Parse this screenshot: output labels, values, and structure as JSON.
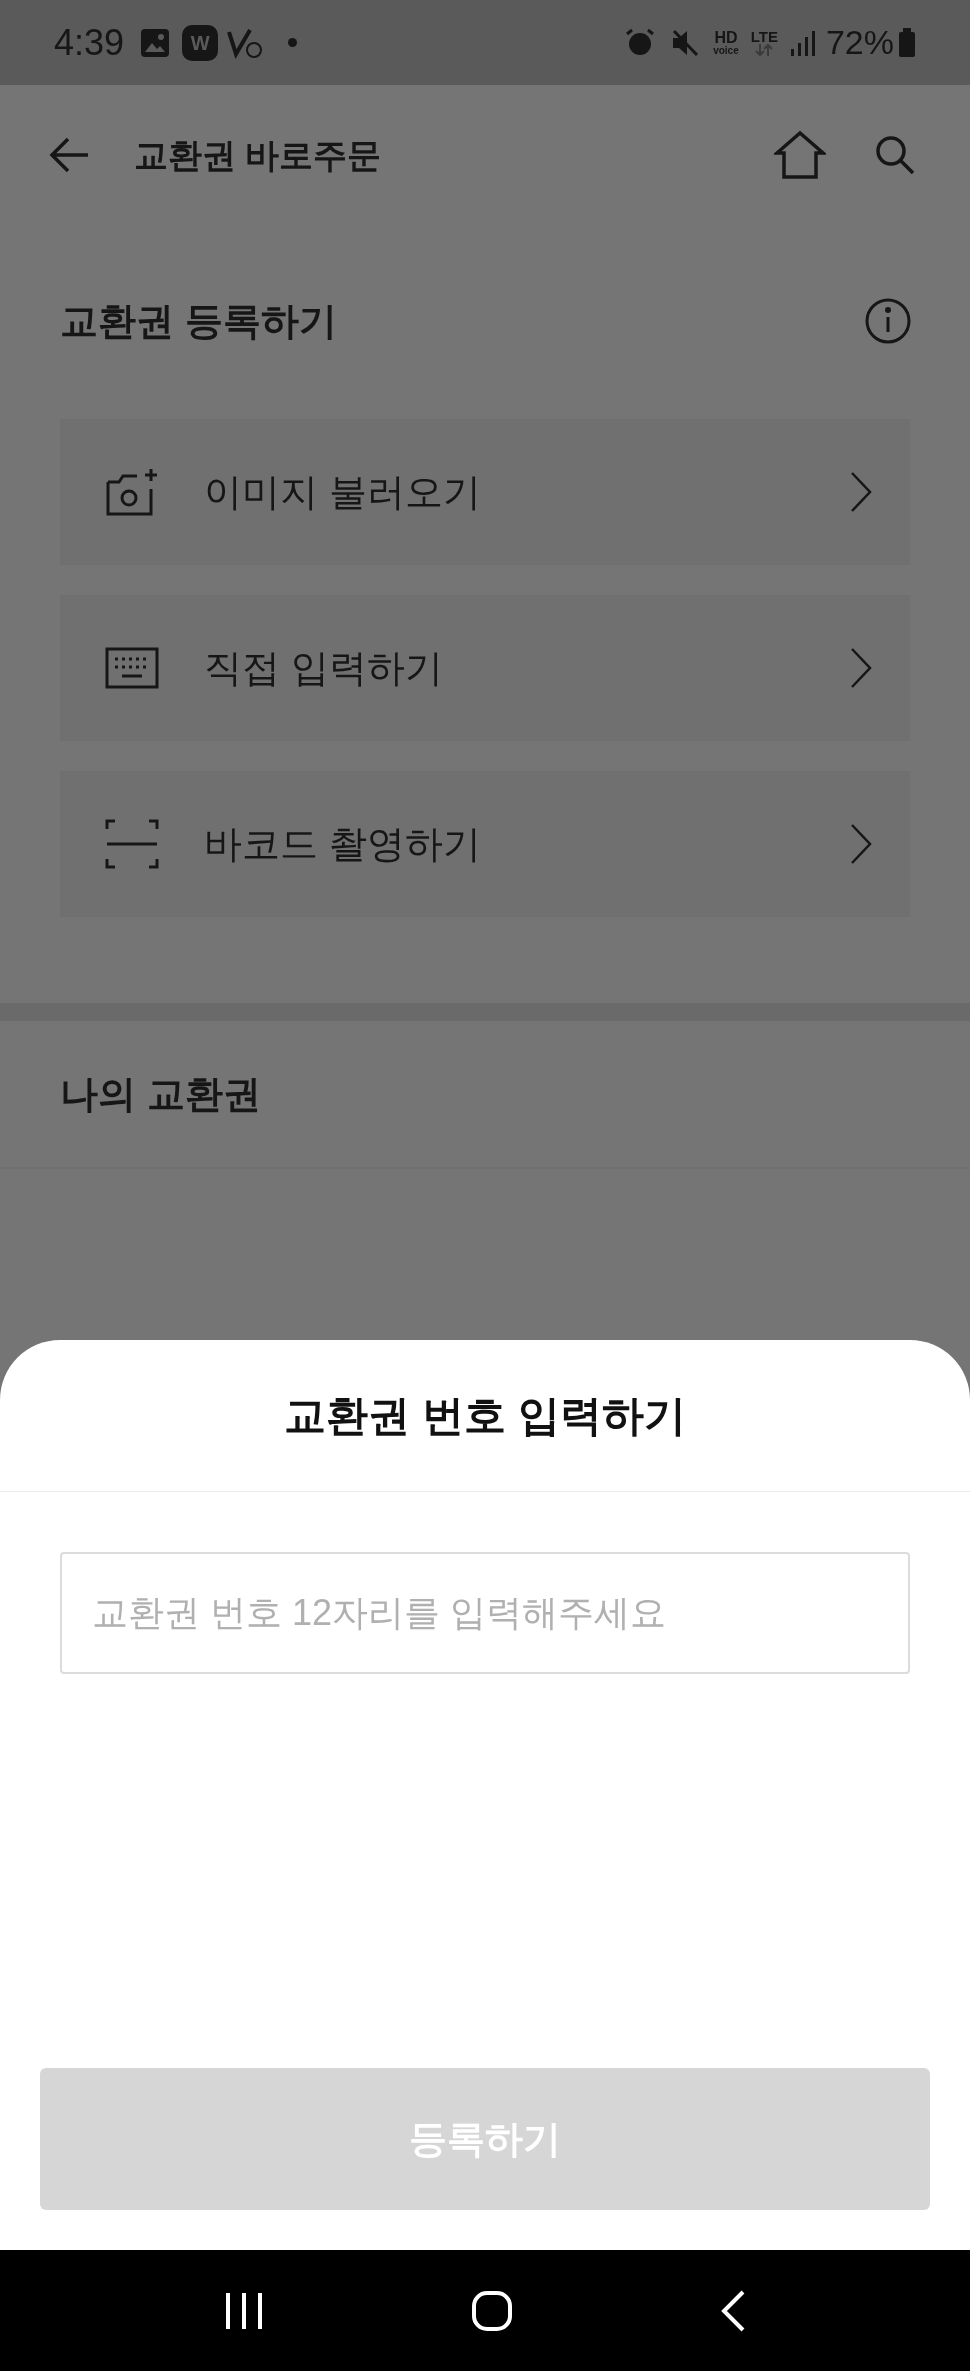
{
  "status_bar": {
    "time": "4:39",
    "app_badge": "W",
    "hd": "HD",
    "voice": "voice",
    "network": "LTE",
    "battery": "72%"
  },
  "header": {
    "title": "교환권 바로주문"
  },
  "register_section": {
    "title": "교환권 등록하기",
    "options": [
      {
        "kind": "image",
        "label": "이미지 불러오기"
      },
      {
        "kind": "keyboard",
        "label": "직접 입력하기"
      },
      {
        "kind": "barcode",
        "label": "바코드 촬영하기"
      }
    ]
  },
  "my_section": {
    "title": "나의 교환권"
  },
  "sheet": {
    "title": "교환권 번호 입력하기",
    "input": {
      "placeholder": "교환권 번호 12자리를 입력해주세요"
    },
    "submit": {
      "label": "등록하기",
      "disabled": true
    }
  }
}
